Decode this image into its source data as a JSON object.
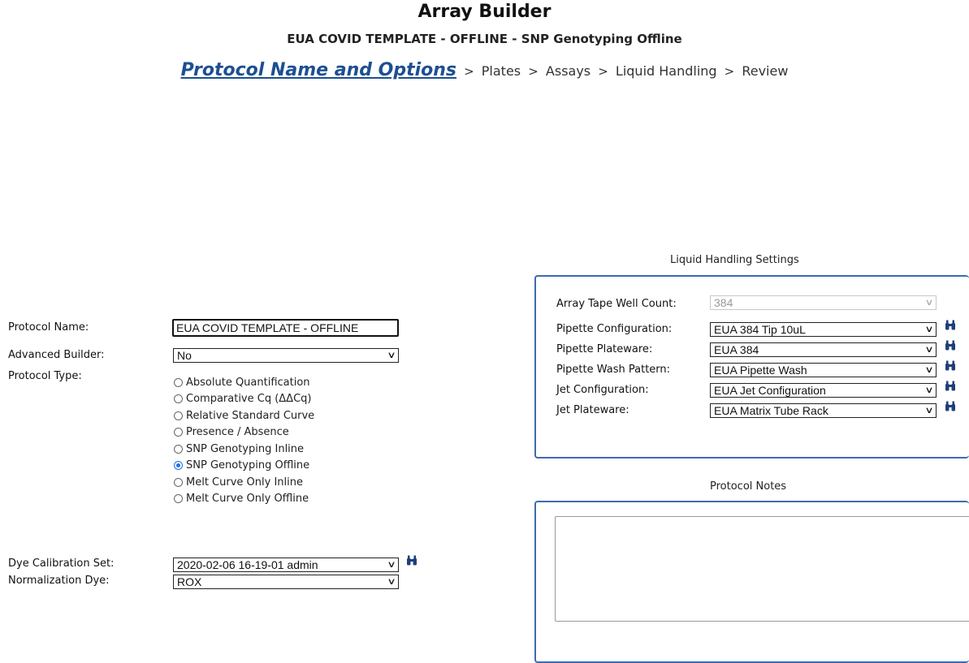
{
  "header": {
    "title": "Array Builder",
    "subtitle": "EUA COVID TEMPLATE - OFFLINE - SNP Genotyping Offline"
  },
  "wizard": {
    "active_step": "Protocol Name and Options",
    "steps": [
      "Plates",
      "Assays",
      "Liquid Handling",
      "Review"
    ],
    "separator": ">"
  },
  "form": {
    "protocol_name_label": "Protocol Name:",
    "protocol_name_value": "EUA COVID TEMPLATE - OFFLINE",
    "advanced_builder_label": "Advanced Builder:",
    "advanced_builder_value": "No",
    "protocol_type_label": "Protocol Type:",
    "protocol_types": [
      "Absolute Quantification",
      "Comparative Cq (ΔΔCq)",
      "Relative Standard Curve",
      "Presence / Absence",
      "SNP Genotyping Inline",
      "SNP Genotyping Offline",
      "Melt Curve Only Inline",
      "Melt Curve Only Offline"
    ],
    "selected_protocol_type": "SNP Genotyping Offline",
    "dye_calibration_label": "Dye Calibration Set:",
    "dye_calibration_value": "2020-02-06 16-19-01 admin",
    "normalization_dye_label": "Normalization Dye:",
    "normalization_dye_value": "ROX"
  },
  "liquid_handling": {
    "title": "Liquid Handling Settings",
    "array_tape_label": "Array Tape Well Count:",
    "array_tape_value": "384",
    "pipette_config_label": "Pipette Configuration:",
    "pipette_config_value": "EUA 384 Tip 10uL",
    "pipette_plateware_label": "Pipette Plateware:",
    "pipette_plateware_value": "EUA 384",
    "pipette_wash_label": "Pipette Wash Pattern:",
    "pipette_wash_value": "EUA Pipette Wash",
    "jet_config_label": "Jet Configuration:",
    "jet_config_value": "EUA Jet Configuration",
    "jet_plateware_label": "Jet Plateware:",
    "jet_plateware_value": "EUA Matrix Tube Rack"
  },
  "notes": {
    "title": "Protocol Notes",
    "value": ""
  },
  "icons": {
    "dropdown": "chevron-down-icon",
    "lookup": "binoculars-icon"
  },
  "colors": {
    "active_step": "#1d4f91",
    "panel_border": "#3d6bb0",
    "radio_checked": "#1a73e8",
    "binoculars": "#1f3f7a"
  }
}
